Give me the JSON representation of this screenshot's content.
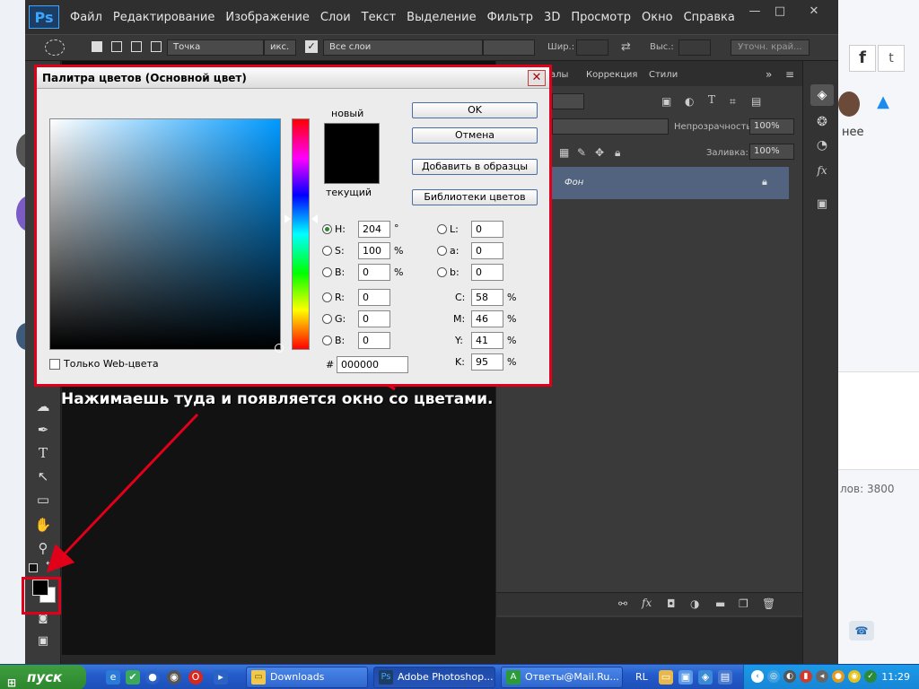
{
  "browser_bg": {
    "right_text_1": "нее",
    "right_text_2": "лов: 3800",
    "icons": [
      "facebook-icon",
      "twitter-icon",
      "bell-icon",
      "phone-icon"
    ]
  },
  "photoshop": {
    "logo": "Ps",
    "menu": [
      "Файл",
      "Редактирование",
      "Изображение",
      "Слои",
      "Текст",
      "Выделение",
      "Фильтр",
      "3D",
      "Просмотр",
      "Окно",
      "Справка"
    ],
    "window_buttons": [
      "—",
      "□",
      "✕"
    ],
    "options": {
      "shape_value": "Точка",
      "pixel_label": "икс.",
      "layers_value": "Все слои",
      "width_label": "Шир.:",
      "height_label": "Выс.:",
      "refine_button": "Уточн. край..."
    },
    "panels": {
      "tabs": [
        "алы",
        "Коррекция",
        "Стили"
      ],
      "opacity_label": "Непрозрачность:",
      "opacity_value": "100%",
      "fill_label": "Заливка:",
      "fill_value": "100%",
      "layer_name": "Фон"
    }
  },
  "annotation": "Нажимаешь туда и появляется окно со цветами.",
  "dialog": {
    "title": "Палитра цветов (Основной цвет)",
    "new_label": "новый",
    "current_label": "текущий",
    "buttons": {
      "ok": "OK",
      "cancel": "Отмена",
      "add_swatches": "Добавить в образцы",
      "color_libraries": "Библиотеки цветов"
    },
    "hsb": {
      "h_label": "H:",
      "h": "204",
      "h_unit": "°",
      "s_label": "S:",
      "s": "100",
      "s_unit": "%",
      "b_label": "B:",
      "b": "0",
      "b_unit": "%"
    },
    "lab": {
      "l_label": "L:",
      "l": "0",
      "a_label": "a:",
      "a": "0",
      "b_label": "b:",
      "b": "0"
    },
    "rgb": {
      "r_label": "R:",
      "r": "0",
      "g_label": "G:",
      "g": "0",
      "b_label": "B:",
      "b": "0"
    },
    "cmyk": {
      "c_label": "C:",
      "c": "58",
      "m_label": "M:",
      "m": "46",
      "y_label": "Y:",
      "y": "41",
      "k_label": "K:",
      "k": "95",
      "unit": "%"
    },
    "hex_label": "#",
    "hex": "000000",
    "web_only_label": "Только Web-цвета"
  },
  "taskbar": {
    "start": "пуск",
    "tasks": [
      "Downloads",
      "Adobe Photoshop...",
      "Ответы@Mail.Ru..."
    ],
    "lang": "RL",
    "clock": "11:29"
  },
  "colors": {
    "highlight": "#e0001a",
    "ps_bg": "#282828",
    "layer_selected": "#526380",
    "base_hue": "#0099ff"
  }
}
